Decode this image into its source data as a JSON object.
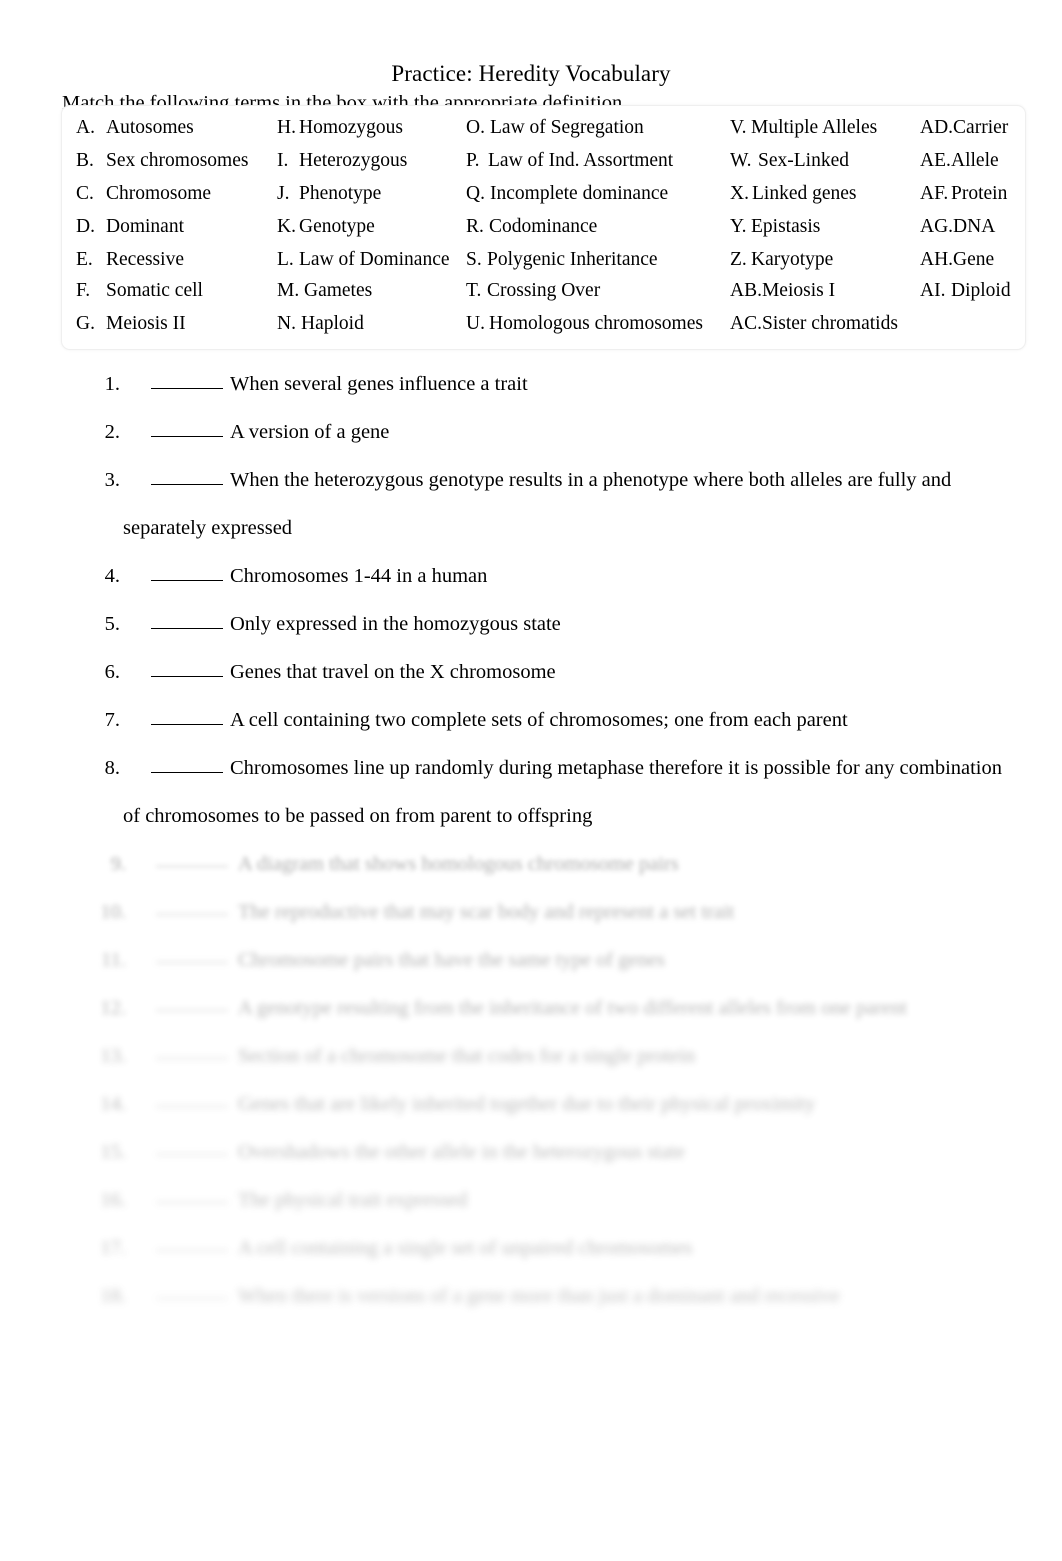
{
  "document": {
    "title": "Practice: Heredity Vocabulary",
    "instruction": "Match the following terms in the box with the appropriate definition."
  },
  "terms_box": {
    "columns": [
      {
        "name": "column-1",
        "items": [
          {
            "label": "A.",
            "text": "Autosomes"
          },
          {
            "label": "B.",
            "text": "Sex chromosomes"
          },
          {
            "label": "C.",
            "text": "Chromosome"
          },
          {
            "label": "D.",
            "text": "Dominant"
          },
          {
            "label": "E.",
            "text": "Recessive"
          },
          {
            "label": "F.",
            "text": "Somatic cell"
          },
          {
            "label": "G.",
            "text": "Meiosis II"
          }
        ]
      },
      {
        "name": "column-2",
        "items": [
          {
            "label": "H.",
            "text": "Homozygous"
          },
          {
            "label": "I.",
            "text": "Heterozygous"
          },
          {
            "label": "J.",
            "text": "Phenotype"
          },
          {
            "label": "K.",
            "text": "Genotype"
          },
          {
            "label": "L.",
            "text": "Law of Dominance"
          },
          {
            "label": "M.",
            "text": "Gametes"
          },
          {
            "label": "N.",
            "text": "Haploid"
          }
        ]
      },
      {
        "name": "column-3",
        "items": [
          {
            "label": "O.",
            "text": "Law of Segregation"
          },
          {
            "label": "P.",
            "text": "Law of Ind. Assortment"
          },
          {
            "label": "Q.",
            "text": "Incomplete dominance"
          },
          {
            "label": "R.",
            "text": "Codominance"
          },
          {
            "label": "S.",
            "text": "Polygenic Inheritance"
          },
          {
            "label": "T.",
            "text": "Crossing Over"
          },
          {
            "label": "U.",
            "text": "Homologous chromosomes"
          }
        ]
      },
      {
        "name": "column-4",
        "items": [
          {
            "label": "V.",
            "text": "Multiple Alleles"
          },
          {
            "label": "W.",
            "text": "Sex-Linked"
          },
          {
            "label": "X.",
            "text": "Linked genes"
          },
          {
            "label": "Y.",
            "text": "Epistasis"
          },
          {
            "label": "Z.",
            "text": "Karyotype"
          },
          {
            "label": "AB.",
            "text": "Meiosis I"
          },
          {
            "label": "AC.",
            "text": "Sister chromatids"
          }
        ]
      },
      {
        "name": "column-5",
        "items": [
          {
            "label": "AD.",
            "text": "Carrier"
          },
          {
            "label": "AE.",
            "text": "Allele"
          },
          {
            "label": "AF.",
            "text": "Protein"
          },
          {
            "label": "AG.",
            "text": "DNA"
          },
          {
            "label": "AH.",
            "text": "Gene"
          },
          {
            "label": "AI.",
            "text": "Diploid"
          }
        ]
      }
    ]
  },
  "questions": [
    {
      "number": "1.",
      "text": "When several genes influence a trait",
      "continuation": ""
    },
    {
      "number": "2.",
      "text": "A version of a gene",
      "continuation": ""
    },
    {
      "number": "3.",
      "text": "When the heterozygous genotype results in a phenotype where both alleles are fully and",
      "continuation": "separately expressed"
    },
    {
      "number": "4.",
      "text": "Chromosomes 1-44 in a human",
      "continuation": ""
    },
    {
      "number": "5.",
      "text": "Only expressed in the homozygous state",
      "continuation": ""
    },
    {
      "number": "6.",
      "text": "Genes that travel on the X chromosome",
      "continuation": ""
    },
    {
      "number": "7.",
      "text": "A cell containing two complete sets of chromosomes; one from each parent",
      "continuation": ""
    },
    {
      "number": "8.",
      "text": "Chromosomes line up randomly during metaphase therefore it is possible for any combination",
      "continuation": "of chromosomes to be passed on from parent to offspring"
    }
  ],
  "faded_questions": [
    {
      "number": "9.",
      "text": "A diagram that shows homologous chromosome pairs"
    },
    {
      "number": "10.",
      "text": "The reproductive that may scar body and represent a set trait"
    },
    {
      "number": "11.",
      "text": "Chromosome pairs that have the same type of genes"
    },
    {
      "number": "12.",
      "text": "A genotype resulting from the inheritance of two different alleles from one parent"
    },
    {
      "number": "13.",
      "text": "Section of a chromosome that codes for a single protein"
    },
    {
      "number": "14.",
      "text": "Genes that are likely inherited together due to their physical proximity"
    },
    {
      "number": "15.",
      "text": "Overshadows the other allele in the heterozygous state"
    },
    {
      "number": "16.",
      "text": "The physical trait expressed"
    },
    {
      "number": "17.",
      "text": "A cell containing a single set of unpaired chromosomes"
    },
    {
      "number": "18.",
      "text": "When there is versions of a gene more than just a dominant and recessive"
    }
  ]
}
